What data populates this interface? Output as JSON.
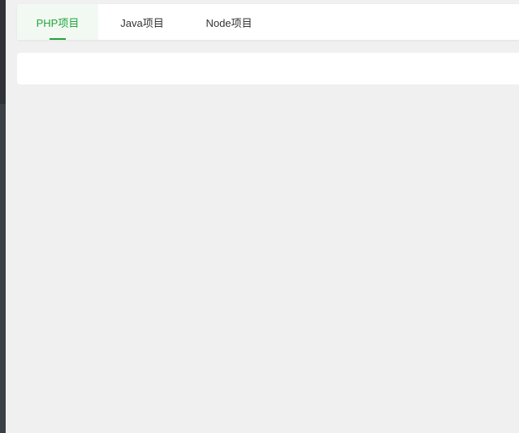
{
  "tabs": [
    {
      "label": "PHP项目",
      "active": true
    },
    {
      "label": "Java项目",
      "active": false
    },
    {
      "label": "Node项目",
      "active": false
    }
  ],
  "colors": {
    "accent": "#20a53a",
    "background": "#f0f0f0",
    "panel": "#ffffff",
    "text": "#333333",
    "sidebar": "#3b3f46"
  }
}
